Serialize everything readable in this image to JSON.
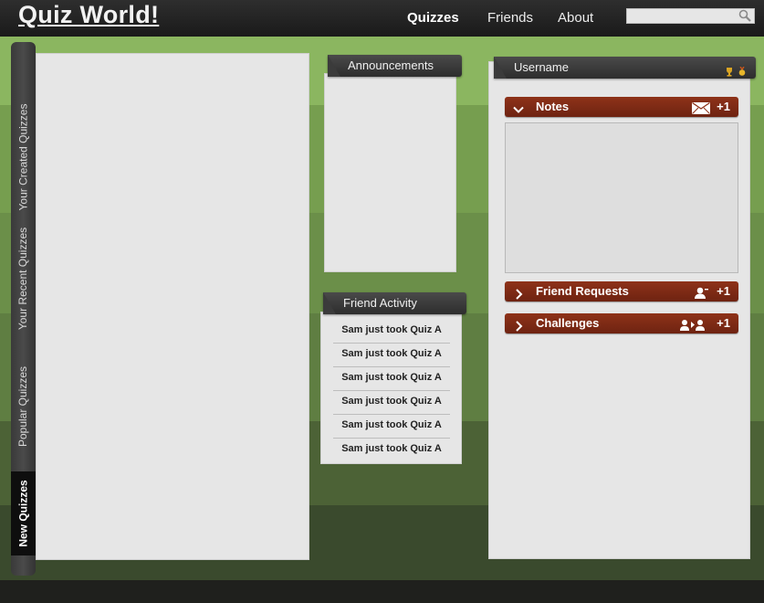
{
  "app": {
    "title": "Quiz World!"
  },
  "nav": {
    "items": [
      {
        "label": "Quizzes",
        "active": true
      },
      {
        "label": "Friends",
        "active": false
      },
      {
        "label": "About",
        "active": false
      }
    ],
    "search": {
      "placeholder": "",
      "value": "",
      "icon": "magnifier-icon"
    }
  },
  "sidebar": {
    "tabs": [
      {
        "label": "Your Created Quizzes",
        "active": false
      },
      {
        "label": "Your Recent Quizzes",
        "active": false
      },
      {
        "label": "Popular Quizzes",
        "active": false
      },
      {
        "label": "New Quizzes",
        "active": true
      }
    ]
  },
  "announcements": {
    "title": "Announcements"
  },
  "friend_activity": {
    "title": "Friend Activity",
    "items": [
      "Sam just took Quiz A",
      "Sam just took Quiz A",
      "Sam just took Quiz A",
      "Sam just took Quiz A",
      "Sam just took Quiz A",
      "Sam just took Quiz A"
    ]
  },
  "user": {
    "title": "Username",
    "badges": [
      "trophy-icon",
      "medal-icon"
    ],
    "sections": {
      "notes": {
        "label": "Notes",
        "icon": "envelope-icon",
        "count": "+1",
        "expanded": true
      },
      "friend_requests": {
        "label": "Friend Requests",
        "icon": "person-icon",
        "count": "+1",
        "expanded": false
      },
      "challenges": {
        "label": "Challenges",
        "icon": "versus-icon",
        "count": "+1",
        "expanded": false
      }
    }
  },
  "colors": {
    "accent_red": "#7e2a15",
    "header_dark": "#333333",
    "panel_bg": "#e6e6e6",
    "green_band": "#8bb660"
  }
}
